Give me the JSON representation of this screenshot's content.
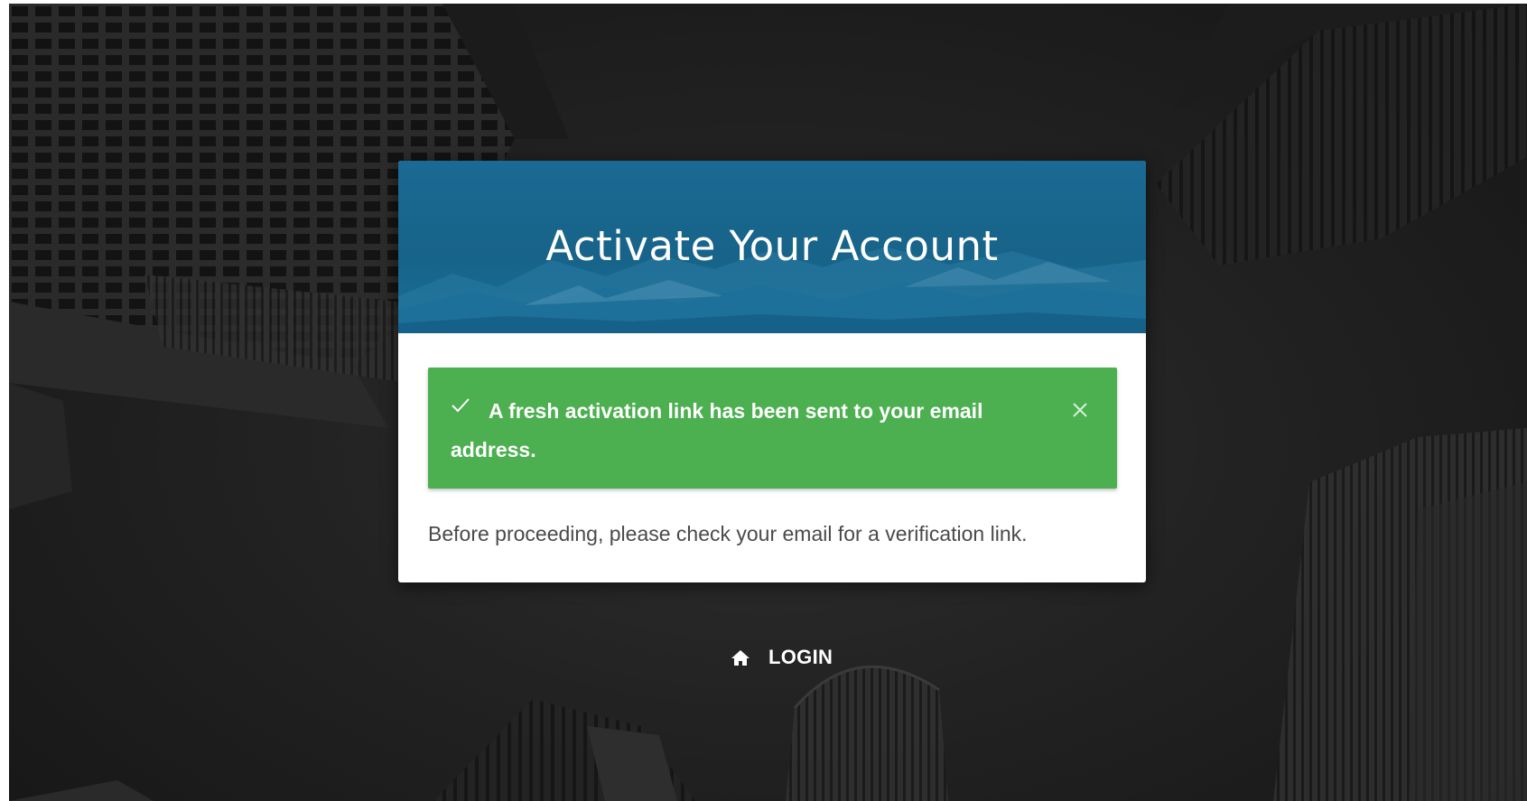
{
  "page": {
    "title": "Activate Your Account"
  },
  "alert": {
    "type": "success",
    "icon": "check-icon",
    "message": "A fresh activation link has been sent to your email address.",
    "close_icon": "close-icon",
    "color": "#4caf50"
  },
  "body": {
    "text": "Before proceeding, please check your email for a verification link."
  },
  "footer": {
    "login_icon": "home-icon",
    "login_label": "LOGIN"
  },
  "colors": {
    "header": "#176389",
    "background": "#1e1e1e",
    "card": "#ffffff"
  }
}
